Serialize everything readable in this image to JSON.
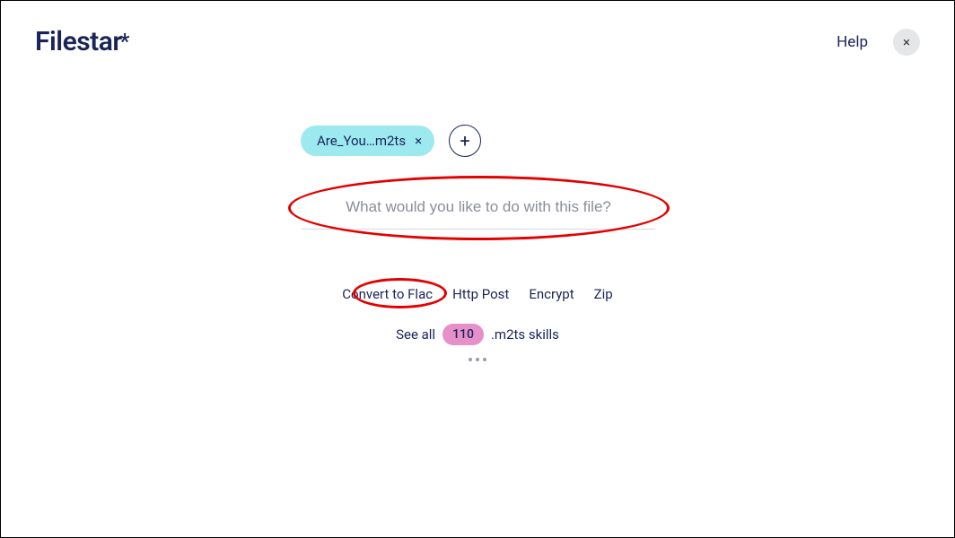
{
  "header": {
    "brand": "Filestar",
    "brand_suffix": "*",
    "help_label": "Help",
    "close_glyph": "×"
  },
  "file_chip": {
    "label": "Are_You…m2ts",
    "remove_glyph": "×"
  },
  "add_button": {
    "glyph": "+"
  },
  "search": {
    "placeholder": "What would you like to do with this file?"
  },
  "skills": {
    "items": [
      "Convert to Flac",
      "Http Post",
      "Encrypt",
      "Zip"
    ]
  },
  "see_all": {
    "prefix": "See all",
    "count": "110",
    "suffix": ".m2ts skills"
  },
  "annotations": {
    "input_highlight": true,
    "skill_highlight_index": 0
  }
}
